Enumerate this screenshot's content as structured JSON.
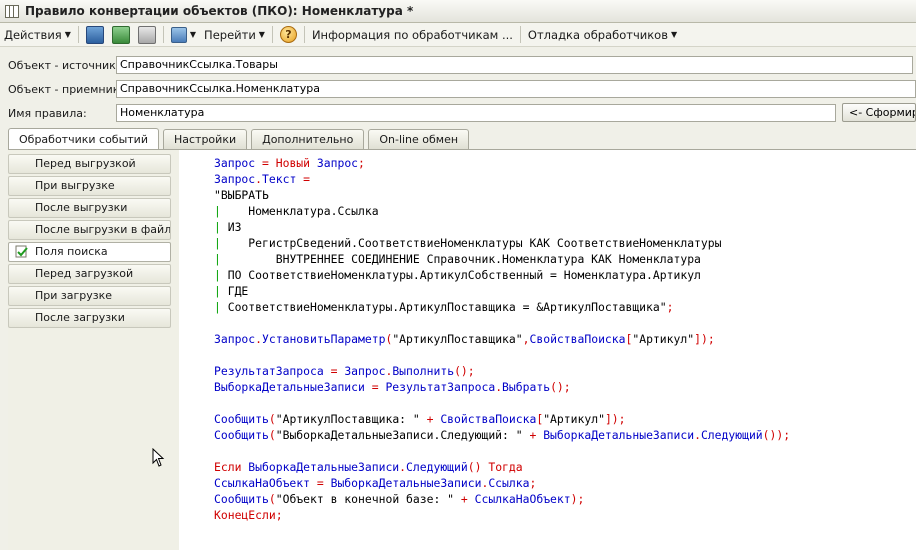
{
  "window": {
    "title": "Правило конвертации объектов (ПКО): Номенклатура *"
  },
  "toolbar": {
    "actions": "Действия",
    "goto": "Перейти",
    "handlers_info": "Информация по обработчикам ...",
    "debug": "Отладка обработчиков"
  },
  "form": {
    "source_label": "Объект - источник:",
    "source_value": "СправочникСсылка.Товары",
    "target_label": "Объект - приемник:",
    "target_value": "СправочникСсылка.Номенклатура",
    "rule_label": "Имя правила:",
    "rule_value": "Номенклатура",
    "generate_button": "<- Сформировать"
  },
  "tabs": [
    {
      "label": "Обработчики событий",
      "active": true
    },
    {
      "label": "Настройки",
      "active": false
    },
    {
      "label": "Дополнительно",
      "active": false
    },
    {
      "label": "On-line обмен",
      "active": false
    }
  ],
  "handlers": [
    {
      "label": "Перед выгрузкой",
      "active": false
    },
    {
      "label": "При выгрузке",
      "active": false
    },
    {
      "label": "После выгрузки",
      "active": false
    },
    {
      "label": "После выгрузки в файл",
      "active": false
    },
    {
      "label": "Поля поиска",
      "active": true
    },
    {
      "label": "Перед загрузкой",
      "active": false
    },
    {
      "label": "При загрузке",
      "active": false
    },
    {
      "label": "После загрузки",
      "active": false
    }
  ],
  "code": {
    "l1": [
      [
        "v",
        "Запрос"
      ],
      [
        "k",
        " = "
      ],
      [
        "k",
        "Новый"
      ],
      [
        "v",
        " Запрос"
      ],
      [
        "k",
        ";"
      ]
    ],
    "l2": [
      [
        "v",
        "Запрос"
      ],
      [
        "k",
        "."
      ],
      [
        "v",
        "Текст"
      ],
      [
        "k",
        " ="
      ]
    ],
    "l3": [
      [
        "s",
        "\"ВЫБРАТЬ"
      ]
    ],
    "l4": [
      [
        "bar",
        "| "
      ],
      [
        "s",
        "   Номенклатура.Ссылка"
      ]
    ],
    "l5": [
      [
        "bar",
        "| "
      ],
      [
        "s",
        "ИЗ"
      ]
    ],
    "l6": [
      [
        "bar",
        "| "
      ],
      [
        "s",
        "   РегистрСведений.СоответствиеНоменклатуры КАК СоответствиеНоменклатуры"
      ]
    ],
    "l7": [
      [
        "bar",
        "| "
      ],
      [
        "s",
        "       ВНУТРЕННЕЕ СОЕДИНЕНИЕ Справочник.Номенклатура КАК Номенклатура"
      ]
    ],
    "l8": [
      [
        "bar",
        "| "
      ],
      [
        "s",
        "ПО СоответствиеНоменклатуры.АртикулСобственный = Номенклатура.Артикул"
      ]
    ],
    "l9": [
      [
        "bar",
        "| "
      ],
      [
        "s",
        "ГДЕ"
      ]
    ],
    "l10": [
      [
        "bar",
        "| "
      ],
      [
        "s",
        "СоответствиеНоменклатуры.АртикулПоставщика = &АртикулПоставщика\""
      ],
      [
        "k",
        ";"
      ]
    ],
    "l11": [
      [
        "v",
        "Запрос"
      ],
      [
        "k",
        "."
      ],
      [
        "v",
        "УстановитьПараметр"
      ],
      [
        "k",
        "("
      ],
      [
        "s",
        "\"АртикулПоставщика\""
      ],
      [
        "k",
        ","
      ],
      [
        "v",
        "СвойстваПоиска"
      ],
      [
        "k",
        "["
      ],
      [
        "s",
        "\"Артикул\""
      ],
      [
        "k",
        "]);"
      ]
    ],
    "l12": [
      [
        "v",
        "РезультатЗапроса"
      ],
      [
        "k",
        " = "
      ],
      [
        "v",
        "Запрос"
      ],
      [
        "k",
        "."
      ],
      [
        "v",
        "Выполнить"
      ],
      [
        "k",
        "();"
      ]
    ],
    "l13": [
      [
        "v",
        "ВыборкаДетальныеЗаписи"
      ],
      [
        "k",
        " = "
      ],
      [
        "v",
        "РезультатЗапроса"
      ],
      [
        "k",
        "."
      ],
      [
        "v",
        "Выбрать"
      ],
      [
        "k",
        "();"
      ]
    ],
    "l14": [
      [
        "v",
        "Сообщить"
      ],
      [
        "k",
        "("
      ],
      [
        "s",
        "\"АртикулПоставщика: \""
      ],
      [
        "k",
        " + "
      ],
      [
        "v",
        "СвойстваПоиска"
      ],
      [
        "k",
        "["
      ],
      [
        "s",
        "\"Артикул\""
      ],
      [
        "k",
        "]);"
      ]
    ],
    "l15": [
      [
        "v",
        "Сообщить"
      ],
      [
        "k",
        "("
      ],
      [
        "s",
        "\"ВыборкаДетальныеЗаписи.Следующий: \""
      ],
      [
        "k",
        " + "
      ],
      [
        "v",
        "ВыборкаДетальныеЗаписи"
      ],
      [
        "k",
        "."
      ],
      [
        "v",
        "Следующий"
      ],
      [
        "k",
        "());"
      ]
    ],
    "l16": [
      [
        "k",
        "Если "
      ],
      [
        "v",
        "ВыборкаДетальныеЗаписи"
      ],
      [
        "k",
        "."
      ],
      [
        "v",
        "Следующий"
      ],
      [
        "k",
        "() Тогда"
      ]
    ],
    "l17": [
      [
        "v",
        "СсылкаНаОбъект"
      ],
      [
        "k",
        " = "
      ],
      [
        "v",
        "ВыборкаДетальныеЗаписи"
      ],
      [
        "k",
        "."
      ],
      [
        "v",
        "Ссылка"
      ],
      [
        "k",
        ";"
      ]
    ],
    "l18": [
      [
        "v",
        "Сообщить"
      ],
      [
        "k",
        "("
      ],
      [
        "s",
        "\"Объект в конечной базе: \""
      ],
      [
        "k",
        " + "
      ],
      [
        "v",
        "СсылкаНаОбъект"
      ],
      [
        "k",
        ");"
      ]
    ],
    "l19": [
      [
        "k",
        "КонецЕсли;"
      ]
    ]
  }
}
